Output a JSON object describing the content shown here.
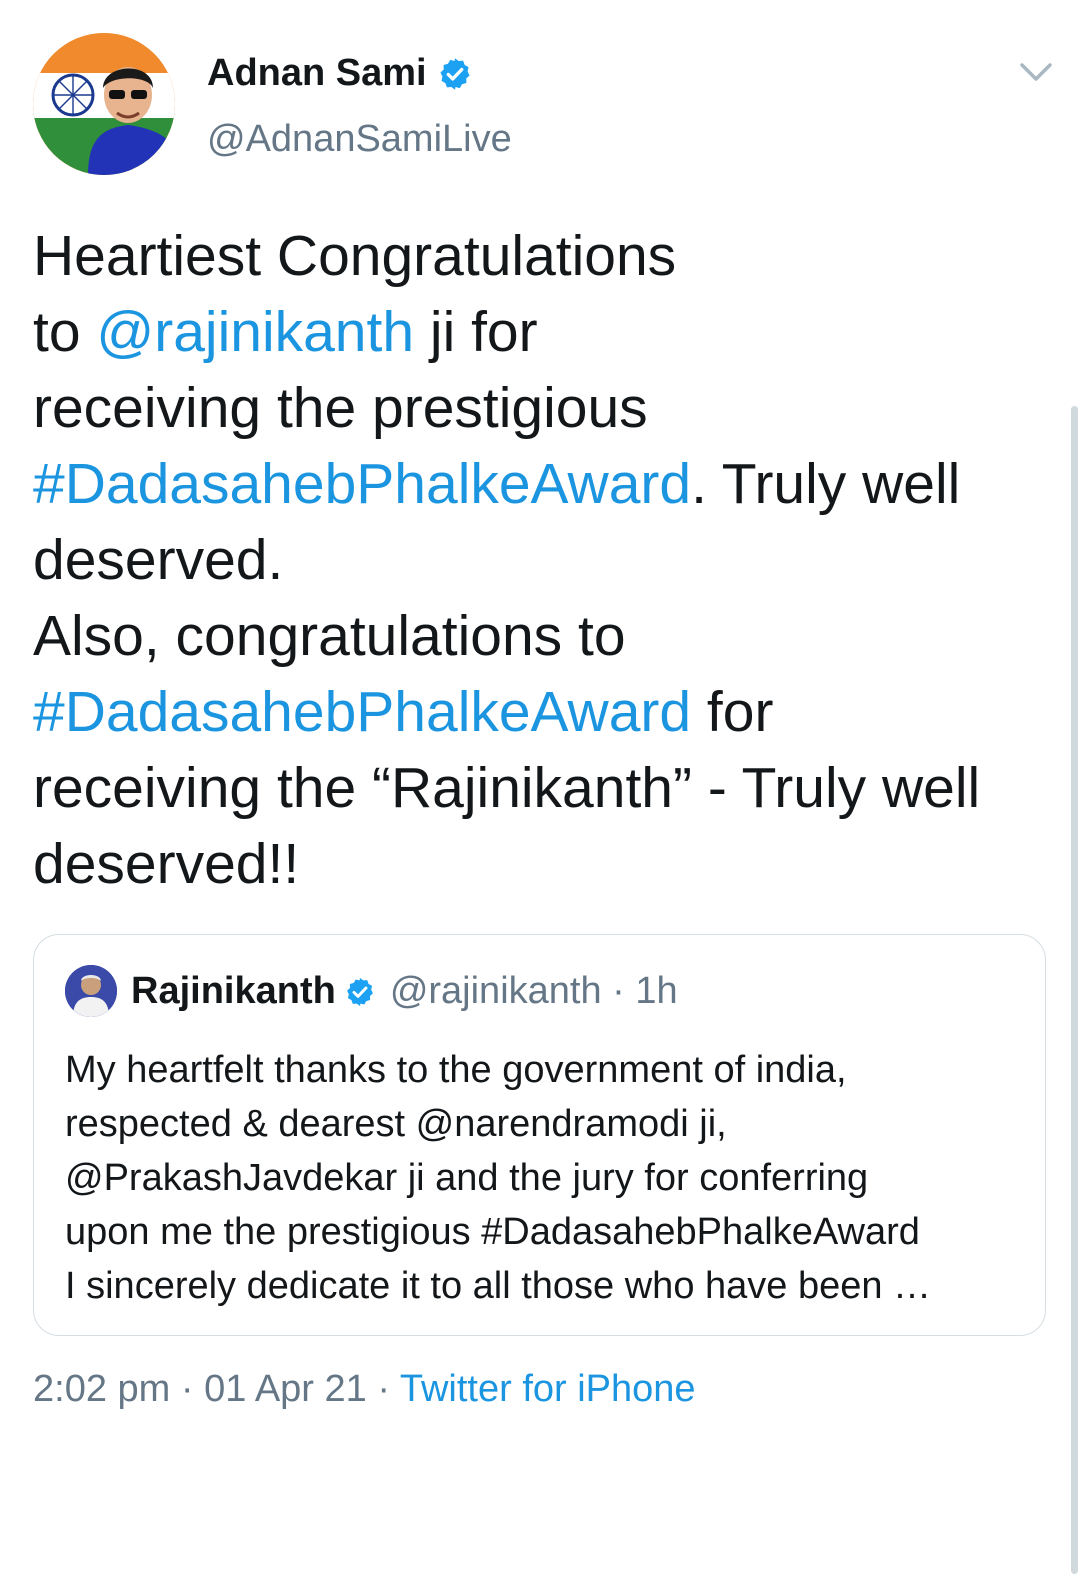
{
  "tweet": {
    "author": {
      "name": "Adnan Sami",
      "handle": "@AdnanSamiLive",
      "avatar_icon": "profile-photo-icon",
      "verified_icon": "verified-badge-icon"
    },
    "menu_icon": "chevron-down-icon",
    "text_segments": [
      {
        "text": "Heartiest Congratulations\nto ",
        "type": "text"
      },
      {
        "text": "@rajinikanth",
        "type": "link"
      },
      {
        "text": " ji for\nreceiving the prestigious\n",
        "type": "text"
      },
      {
        "text": "#DadasahebPhalkeAward",
        "type": "link"
      },
      {
        "text": ". Truly well\ndeserved.\nAlso, congratulations to\n",
        "type": "text"
      },
      {
        "text": "#DadasahebPhalkeAward",
        "type": "link"
      },
      {
        "text": " for\nreceiving the “Rajinikanth” - Truly well\ndeserved!!",
        "type": "text"
      }
    ],
    "quoted": {
      "name": "Rajinikanth",
      "handle": "@rajinikanth",
      "time": "· 1h",
      "text": "My heartfelt thanks to the government of india,\nrespected & dearest @narendramodi ji,\n@PrakashJavdekar ji and the jury for conferring\nupon me the prestigious #DadasahebPhalkeAward\nI sincerely dedicate it to all those who have been …"
    },
    "meta": {
      "time": "2:02 pm",
      "date": "01 Apr 21",
      "separator": " · ",
      "source": "Twitter for iPhone"
    }
  },
  "colors": {
    "text": "#14171a",
    "secondary": "#657786",
    "link": "#1b95e0",
    "border": "#d6dee3"
  }
}
